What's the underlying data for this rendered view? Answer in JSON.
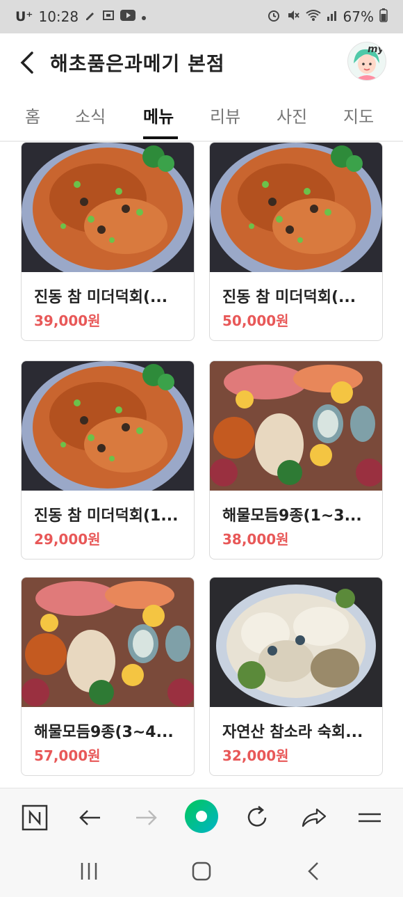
{
  "status_bar": {
    "carrier": "U⁺",
    "time": "10:28",
    "battery": "67%"
  },
  "header": {
    "title": "해초품은과메기 본점",
    "my_label": "my"
  },
  "tabs": [
    {
      "label": "홈",
      "active": false
    },
    {
      "label": "소식",
      "active": false
    },
    {
      "label": "메뉴",
      "active": true
    },
    {
      "label": "리뷰",
      "active": false
    },
    {
      "label": "사진",
      "active": false
    },
    {
      "label": "지도",
      "active": false
    }
  ],
  "menu_items": [
    {
      "name": "진동 참 미더덕회(...",
      "price": "39,000원",
      "image": "spicy-sea-squirt-platter"
    },
    {
      "name": "진동 참 미더덕회(...",
      "price": "50,000원",
      "image": "spicy-sea-squirt-platter"
    },
    {
      "name": "진동 참 미더덕회(1...",
      "price": "29,000원",
      "image": "spicy-sea-squirt-platter"
    },
    {
      "name": "해물모듬9종(1~3...",
      "price": "38,000원",
      "image": "seafood-assortment-platter"
    },
    {
      "name": "해물모듬9종(3~4...",
      "price": "57,000원",
      "image": "seafood-assortment-platter"
    },
    {
      "name": "자연산 참소라 숙회...",
      "price": "32,000원",
      "image": "whelk-platter"
    }
  ],
  "browser_bar": {
    "icons": [
      "naver-n-icon",
      "back-arrow-icon",
      "forward-arrow-icon",
      "green-dot-home-icon",
      "refresh-icon",
      "share-icon",
      "menu-icon"
    ]
  },
  "colors": {
    "price": "#e85858",
    "accent_green": "#03c75a"
  }
}
